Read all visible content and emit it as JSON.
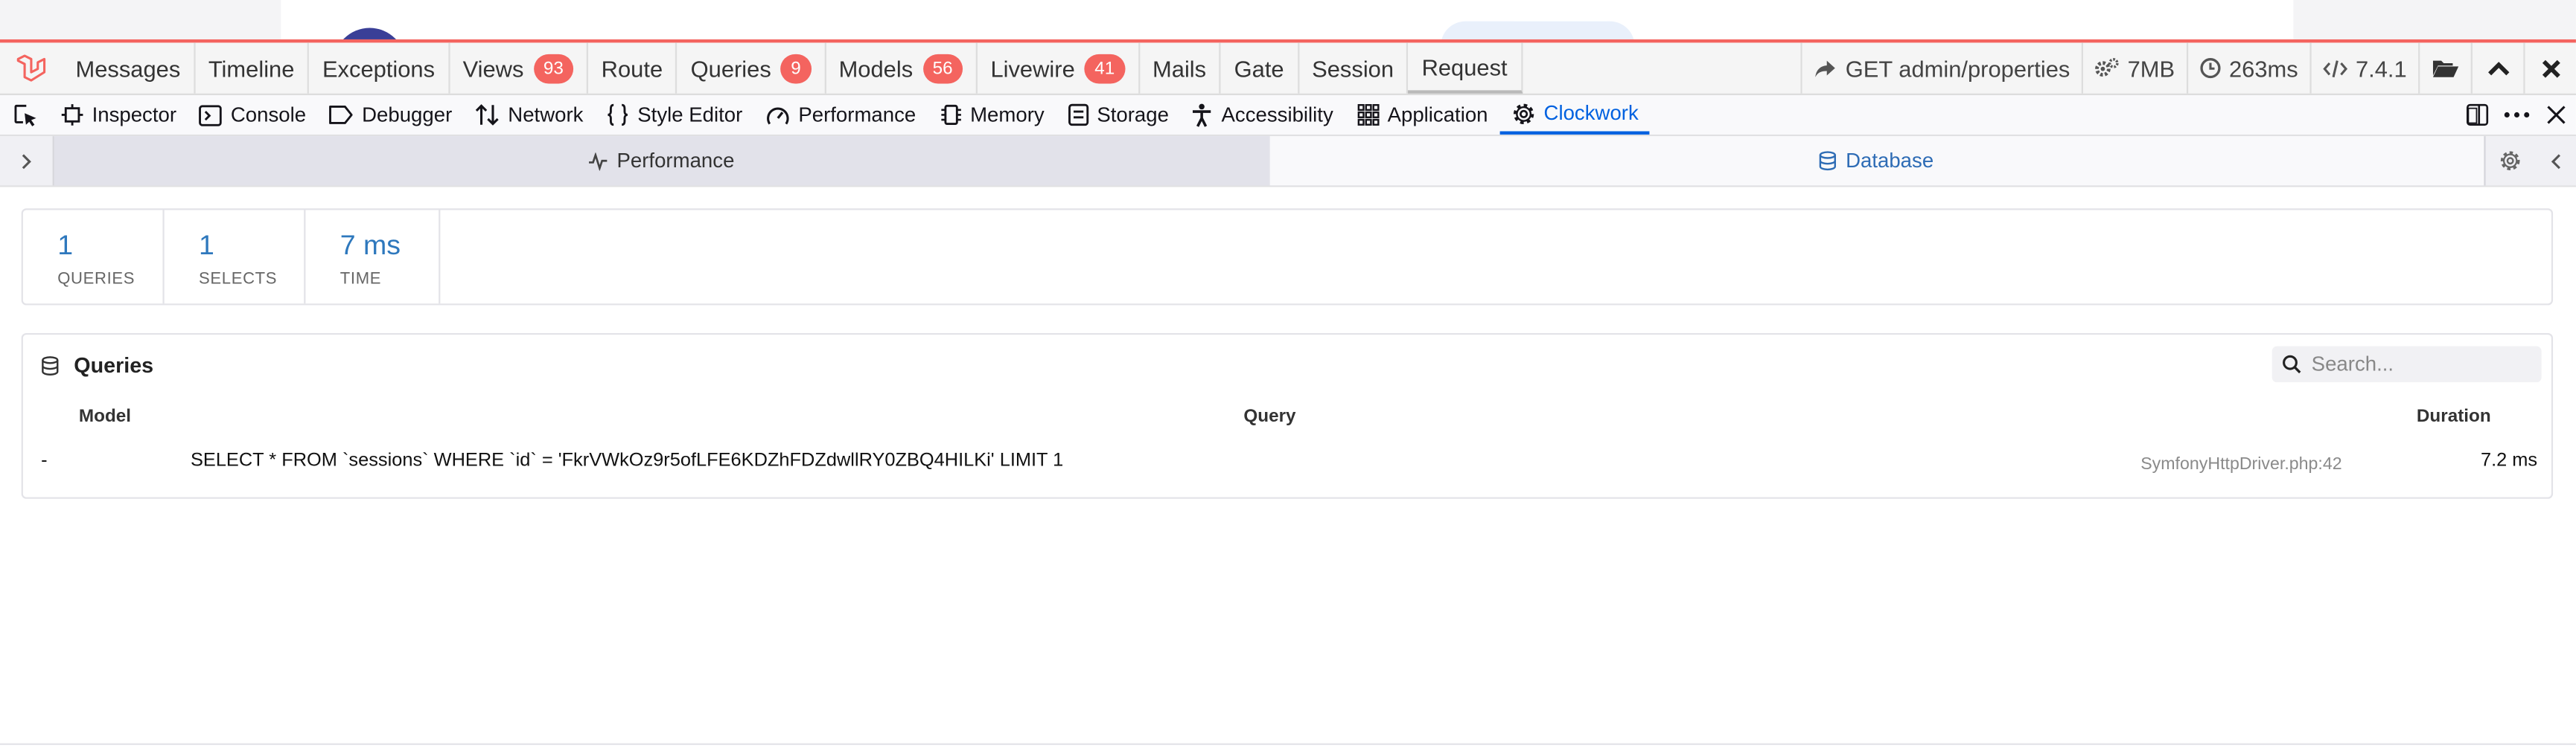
{
  "debugbar": {
    "tabs": [
      {
        "label": "Messages",
        "badge": ""
      },
      {
        "label": "Timeline",
        "badge": ""
      },
      {
        "label": "Exceptions",
        "badge": ""
      },
      {
        "label": "Views",
        "badge": "93"
      },
      {
        "label": "Route",
        "badge": ""
      },
      {
        "label": "Queries",
        "badge": "9"
      },
      {
        "label": "Models",
        "badge": "56"
      },
      {
        "label": "Livewire",
        "badge": "41"
      },
      {
        "label": "Mails",
        "badge": ""
      },
      {
        "label": "Gate",
        "badge": ""
      },
      {
        "label": "Session",
        "badge": ""
      },
      {
        "label": "Request",
        "badge": ""
      }
    ],
    "request": "GET admin/properties",
    "memory": "7MB",
    "time": "263ms",
    "php_version": "7.4.1",
    "accent_color": "#f4645f"
  },
  "devtools": {
    "tabs": [
      {
        "label": "Inspector"
      },
      {
        "label": "Console"
      },
      {
        "label": "Debugger"
      },
      {
        "label": "Network"
      },
      {
        "label": "Style Editor"
      },
      {
        "label": "Performance"
      },
      {
        "label": "Memory"
      },
      {
        "label": "Storage"
      },
      {
        "label": "Accessibility"
      },
      {
        "label": "Application"
      },
      {
        "label": "Clockwork"
      }
    ],
    "active_tab": "Clockwork",
    "accent_color": "#0061e0"
  },
  "panel": {
    "performance_label": "Performance",
    "database_label": "Database"
  },
  "stats": [
    {
      "value": "1",
      "label": "QUERIES"
    },
    {
      "value": "1",
      "label": "SELECTS"
    },
    {
      "value": "7 ms",
      "label": "TIME"
    }
  ],
  "queries": {
    "title": "Queries",
    "search_placeholder": "Search...",
    "columns": {
      "model": "Model",
      "query": "Query",
      "duration": "Duration"
    },
    "rows": [
      {
        "model": "-",
        "query": "SELECT * FROM `sessions` WHERE `id` = 'FkrVWkOz9r5ofLFE6KDZhFDZdwllRY0ZBQ4HILKi' LIMIT 1",
        "source": "SymfonyHttpDriver.php:42",
        "duration": "7.2 ms"
      }
    ]
  }
}
